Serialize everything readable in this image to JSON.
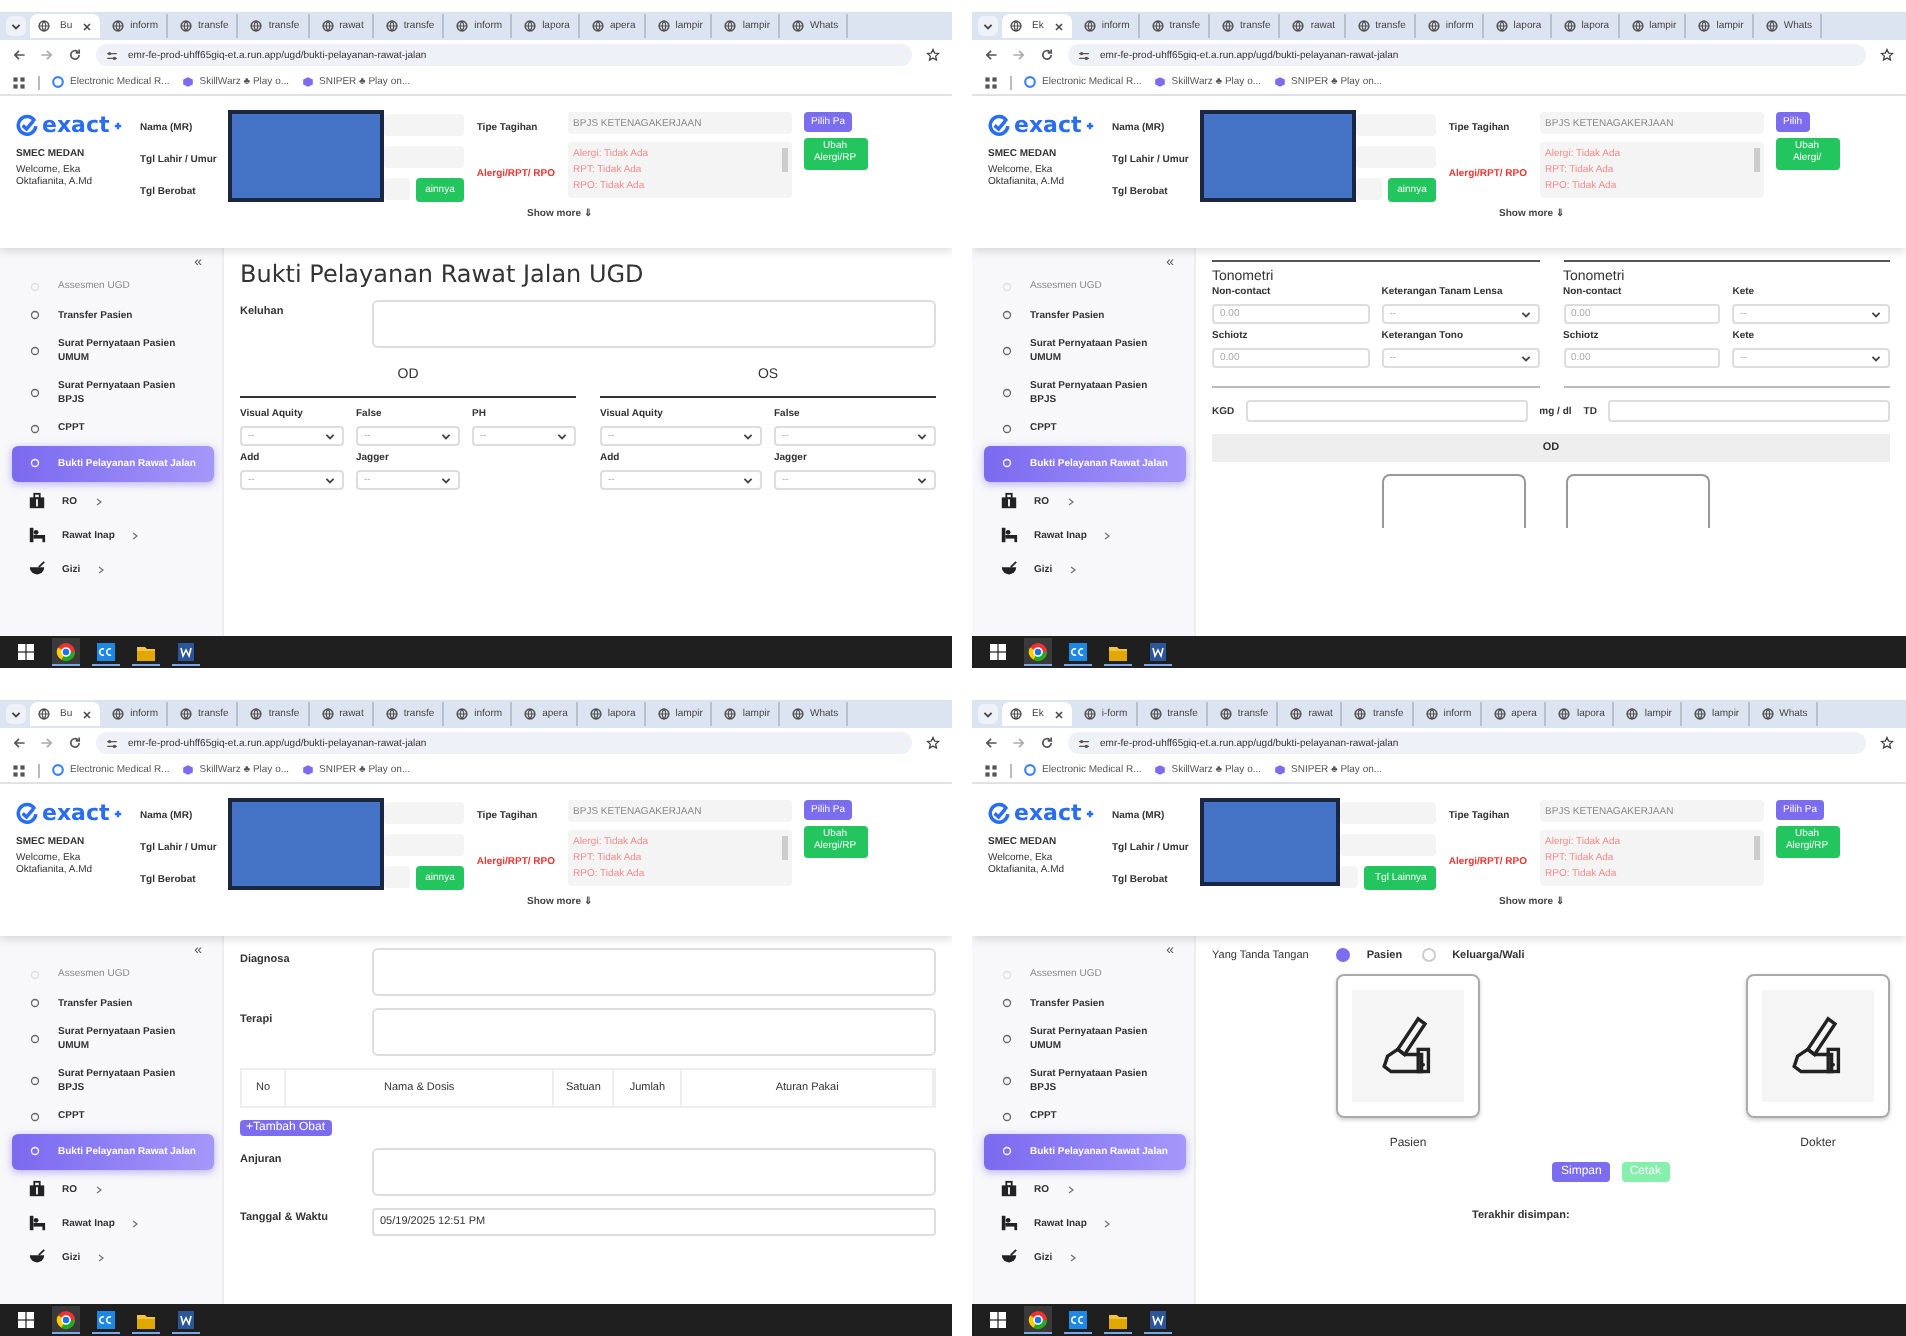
{
  "panels": [
    {
      "tabs": [
        {
          "label": "Bu",
          "selected": true
        },
        {
          "label": "inform",
          "selected": false
        },
        {
          "label": "transfe",
          "selected": false
        },
        {
          "label": "transfe",
          "selected": false
        },
        {
          "label": "rawat",
          "selected": false
        },
        {
          "label": "transfe",
          "selected": false
        },
        {
          "label": "inform",
          "selected": false
        },
        {
          "label": "lapora",
          "selected": false
        },
        {
          "label": "apera",
          "selected": false
        },
        {
          "label": "lampir",
          "selected": false
        },
        {
          "label": "lampir",
          "selected": false
        },
        {
          "label": "Whats",
          "selected": false
        }
      ],
      "url": "emr-fe-prod-uhff65giq-et.a.run.app/ugd/bukti-pelayanan-rawat-jalan",
      "bookmarks": [
        "Electronic Medical R...",
        "SkillWarz ♣ Play o...",
        "SNIPER ♣ Play on..."
      ],
      "header": {
        "logo": "exact",
        "clinic": "SMEC MEDAN",
        "welcome": "Welcome, Eka Oktafianita, A.Md",
        "labels": [
          "Nama (MR)",
          "Tgl Lahir / Umur",
          "Tgl Berobat"
        ],
        "date_button": "ainnya",
        "billing_label": "Tipe Tagihan",
        "billing_value": "BPJS KETENAGAKERJAAN",
        "allergy_label": "Alergi/RPT/ RPO",
        "allergy_lines": [
          "Alergi: Tidak Ada",
          "RPT: Tidak Ada",
          "RPO: Tidak Ada"
        ],
        "show_more": "Show more ⇓",
        "pick_button": "Pilih Pa",
        "edit_button": "Ubah Alergi/RP"
      },
      "sidebar": {
        "collapse": "«",
        "items": [
          {
            "label": "Assesmen UGD",
            "selected": false,
            "dimmed": true
          },
          {
            "label": "Transfer Pasien",
            "selected": false,
            "dimmed": false
          },
          {
            "label": "Surat Pernyataan Pasien UMUM",
            "selected": false,
            "dimmed": false
          },
          {
            "label": "Surat Pernyataan Pasien BPJS",
            "selected": false,
            "dimmed": false
          },
          {
            "label": "CPPT",
            "selected": false,
            "dimmed": false
          },
          {
            "label": "Bukti Pelayanan Rawat Jalan",
            "selected": true,
            "dimmed": false
          }
        ],
        "groups": [
          {
            "label": "RO",
            "kind": "case"
          },
          {
            "label": "Rawat Inap",
            "kind": "bed"
          },
          {
            "label": "Gizi",
            "kind": "bowl"
          }
        ]
      },
      "content": [
        {
          "kind": "title",
          "text": "Bukti Pelayanan Rawat Jalan UGD"
        },
        {
          "kind": "textarea",
          "label": "Keluhan"
        },
        {
          "kind": "grid",
          "sides": [
            {
              "heading": "OD",
              "rows": [
                [
                  {
                    "label": "Visual Aquity",
                    "value": "--",
                    "kind": "select"
                  },
                  {
                    "label": "False",
                    "value": "--",
                    "kind": "select"
                  },
                  {
                    "label": "PH",
                    "value": "--",
                    "kind": "select"
                  }
                ],
                [
                  {
                    "label": "Add",
                    "value": "--",
                    "kind": "select"
                  },
                  {
                    "label": "Jagger",
                    "value": "--",
                    "kind": "select"
                  }
                ]
              ]
            },
            {
              "heading": "OS",
              "rows": [
                [
                  {
                    "label": "Visual Aquity",
                    "value": "--",
                    "kind": "select"
                  },
                  {
                    "label": "False",
                    "value": "--",
                    "kind": "select"
                  }
                ],
                [
                  {
                    "label": "Add",
                    "value": "--",
                    "kind": "select"
                  },
                  {
                    "label": "Jagger",
                    "value": "--",
                    "kind": "select"
                  }
                ]
              ]
            }
          ]
        }
      ]
    },
    {
      "tabs": [
        {
          "label": "Ek",
          "selected": true
        },
        {
          "label": "inform",
          "selected": false
        },
        {
          "label": "transfe",
          "selected": false
        },
        {
          "label": "transfe",
          "selected": false
        },
        {
          "label": "rawat",
          "selected": false
        },
        {
          "label": "transfe",
          "selected": false
        },
        {
          "label": "inform",
          "selected": false
        },
        {
          "label": "lapora",
          "selected": false
        },
        {
          "label": "lapora",
          "selected": false
        },
        {
          "label": "lampir",
          "selected": false
        },
        {
          "label": "lampir",
          "selected": false
        },
        {
          "label": "Whats",
          "selected": false
        }
      ],
      "url": "emr-fe-prod-uhff65giq-et.a.run.app/ugd/bukti-pelayanan-rawat-jalan",
      "bookmarks": [
        "Electronic Medical R...",
        "SkillWarz ♣ Play o...",
        "SNIPER ♣ Play on..."
      ],
      "header": {
        "logo": "exact",
        "clinic": "SMEC MEDAN",
        "welcome": "Welcome, Eka Oktafianita, A.Md",
        "labels": [
          "Nama (MR)",
          "Tgl Lahir / Umur",
          "Tgl Berobat"
        ],
        "date_button": "ainnya",
        "billing_label": "Tipe Tagihan",
        "billing_value": "BPJS KETENAGAKERJAAN",
        "allergy_label": "Alergi/RPT/ RPO",
        "allergy_lines": [
          "Alergi: Tidak Ada",
          "RPT: Tidak Ada",
          "RPO: Tidak Ada"
        ],
        "show_more": "Show more ⇓",
        "pick_button": "Pilih",
        "edit_button": "Ubah Alergi/"
      },
      "sidebar": {
        "collapse": "«",
        "items": [
          {
            "label": "Assesmen UGD",
            "selected": false,
            "dimmed": true
          },
          {
            "label": "Transfer Pasien",
            "selected": false,
            "dimmed": false
          },
          {
            "label": "Surat Pernyataan Pasien UMUM",
            "selected": false,
            "dimmed": false
          },
          {
            "label": "Surat Pernyataan Pasien BPJS",
            "selected": false,
            "dimmed": false
          },
          {
            "label": "CPPT",
            "selected": false,
            "dimmed": false
          },
          {
            "label": "Bukti Pelayanan Rawat Jalan",
            "selected": true,
            "dimmed": false
          }
        ],
        "groups": [
          {
            "label": "RO",
            "kind": "case"
          },
          {
            "label": "Rawat Inap",
            "kind": "bed"
          },
          {
            "label": "Gizi",
            "kind": "bowl"
          }
        ]
      },
      "content": [
        {
          "kind": "grid",
          "sides": [
            {
              "title": "Tonometri",
              "rows": [
                [
                  {
                    "label": "Non-contact",
                    "placeholder": "0.00",
                    "kind": "input"
                  },
                  {
                    "label": "Keterangan Tanam Lensa",
                    "value": "--",
                    "kind": "select"
                  }
                ],
                [
                  {
                    "label": "Schiotz",
                    "placeholder": "0.00",
                    "kind": "input"
                  },
                  {
                    "label": "Keterangan Tono",
                    "value": "--",
                    "kind": "select"
                  }
                ]
              ]
            },
            {
              "title": "Tonometri",
              "rows": [
                [
                  {
                    "label": "Non-contact",
                    "placeholder": "0.00",
                    "kind": "input"
                  },
                  {
                    "label": "Kete",
                    "value": "--",
                    "kind": "select"
                  }
                ],
                [
                  {
                    "label": "Schiotz",
                    "placeholder": "0.00",
                    "kind": "input"
                  },
                  {
                    "label": "Kete",
                    "value": "--",
                    "kind": "select"
                  }
                ]
              ]
            }
          ]
        },
        {
          "kind": "measure",
          "label": "KGD",
          "unit": "mg / dl",
          "label2": "TD"
        },
        {
          "kind": "band",
          "text": "OD"
        },
        {
          "kind": "frames"
        }
      ]
    },
    {
      "tabs": [
        {
          "label": "Bu",
          "selected": true
        },
        {
          "label": "inform",
          "selected": false
        },
        {
          "label": "transfe",
          "selected": false
        },
        {
          "label": "transfe",
          "selected": false
        },
        {
          "label": "rawat",
          "selected": false
        },
        {
          "label": "transfe",
          "selected": false
        },
        {
          "label": "inform",
          "selected": false
        },
        {
          "label": "apera",
          "selected": false
        },
        {
          "label": "lapora",
          "selected": false
        },
        {
          "label": "lampir",
          "selected": false
        },
        {
          "label": "lampir",
          "selected": false
        },
        {
          "label": "Whats",
          "selected": false
        }
      ],
      "url": "emr-fe-prod-uhff65giq-et.a.run.app/ugd/bukti-pelayanan-rawat-jalan",
      "bookmarks": [
        "Electronic Medical R...",
        "SkillWarz ♣ Play o...",
        "SNIPER ♣ Play on..."
      ],
      "header": {
        "logo": "exact",
        "clinic": "SMEC MEDAN",
        "welcome": "Welcome, Eka Oktafianita, A.Md",
        "labels": [
          "Nama (MR)",
          "Tgl Lahir / Umur",
          "Tgl Berobat"
        ],
        "date_button": "ainnya",
        "billing_label": "Tipe Tagihan",
        "billing_value": "BPJS KETENAGAKERJAAN",
        "allergy_label": "Alergi/RPT/ RPO",
        "allergy_lines": [
          "Alergi: Tidak Ada",
          "RPT: Tidak Ada",
          "RPO: Tidak Ada"
        ],
        "show_more": "Show more ⇓",
        "pick_button": "Pilih Pa",
        "edit_button": "Ubah Alergi/RP"
      },
      "sidebar": {
        "collapse": "«",
        "items": [
          {
            "label": "Assesmen UGD",
            "selected": false,
            "dimmed": true
          },
          {
            "label": "Transfer Pasien",
            "selected": false,
            "dimmed": false
          },
          {
            "label": "Surat Pernyataan Pasien UMUM",
            "selected": false,
            "dimmed": false
          },
          {
            "label": "Surat Pernyataan Pasien BPJS",
            "selected": false,
            "dimmed": false
          },
          {
            "label": "CPPT",
            "selected": false,
            "dimmed": false
          },
          {
            "label": "Bukti Pelayanan Rawat Jalan",
            "selected": true,
            "dimmed": false
          }
        ],
        "groups": [
          {
            "label": "RO",
            "kind": "case"
          },
          {
            "label": "Rawat Inap",
            "kind": "bed"
          },
          {
            "label": "Gizi",
            "kind": "bowl"
          }
        ]
      },
      "content": [
        {
          "kind": "textarea",
          "label": "Diagnosa"
        },
        {
          "kind": "textarea",
          "label": "Terapi"
        },
        {
          "kind": "table",
          "columns": [
            "No",
            "Nama & Dosis",
            "Satuan",
            "Jumlah",
            "Aturan Pakai"
          ]
        },
        {
          "kind": "button",
          "text": "+Tambah Obat"
        },
        {
          "kind": "textarea",
          "label": "Anjuran"
        },
        {
          "kind": "input",
          "label": "Tanggal & Waktu",
          "value": "05/19/2025 12:51 PM"
        }
      ]
    },
    {
      "tabs": [
        {
          "label": "Ek",
          "selected": true
        },
        {
          "label": "i-form",
          "selected": false
        },
        {
          "label": "transfe",
          "selected": false
        },
        {
          "label": "transfe",
          "selected": false
        },
        {
          "label": "rawat",
          "selected": false
        },
        {
          "label": "transfe",
          "selected": false
        },
        {
          "label": "inform",
          "selected": false
        },
        {
          "label": "apera",
          "selected": false
        },
        {
          "label": "lapora",
          "selected": false
        },
        {
          "label": "lampir",
          "selected": false
        },
        {
          "label": "lampir",
          "selected": false
        },
        {
          "label": "Whats",
          "selected": false
        }
      ],
      "url": "emr-fe-prod-uhff65giq-et.a.run.app/ugd/bukti-pelayanan-rawat-jalan",
      "bookmarks": [
        "Electronic Medical R...",
        "SkillWarz ♣ Play o...",
        "SNIPER ♣ Play on..."
      ],
      "header": {
        "logo": "exact",
        "clinic": "SMEC MEDAN",
        "welcome": "Welcome, Eka Oktafianita, A.Md",
        "labels": [
          "Nama (MR)",
          "Tgl Lahir / Umur",
          "Tgl Berobat"
        ],
        "date_button": "Tgl Lainnya",
        "billing_label": "Tipe Tagihan",
        "billing_value": "BPJS KETENAGAKERJAAN",
        "allergy_label": "Alergi/RPT/ RPO",
        "allergy_lines": [
          "Alergi: Tidak Ada",
          "RPT: Tidak Ada",
          "RPO: Tidak Ada"
        ],
        "show_more": "Show more ⇓",
        "pick_button": "Pilih Pa",
        "edit_button": "Ubah Alergi/RP"
      },
      "sidebar": {
        "collapse": "«",
        "items": [
          {
            "label": "Assesmen UGD",
            "selected": false,
            "dimmed": true
          },
          {
            "label": "Transfer Pasien",
            "selected": false,
            "dimmed": false
          },
          {
            "label": "Surat Pernyataan Pasien UMUM",
            "selected": false,
            "dimmed": false
          },
          {
            "label": "Surat Pernyataan Pasien BPJS",
            "selected": false,
            "dimmed": false
          },
          {
            "label": "CPPT",
            "selected": false,
            "dimmed": false
          },
          {
            "label": "Bukti Pelayanan Rawat Jalan",
            "selected": true,
            "dimmed": false
          }
        ],
        "groups": [
          {
            "label": "RO",
            "kind": "case"
          },
          {
            "label": "Rawat Inap",
            "kind": "bed"
          },
          {
            "label": "Gizi",
            "kind": "bowl"
          }
        ]
      },
      "content": [
        {
          "kind": "radios",
          "label": "Yang Tanda Tangan",
          "options": [
            {
              "label": "Pasien",
              "selected": true
            },
            {
              "label": "Keluarga/Wali",
              "selected": false
            }
          ]
        },
        {
          "kind": "signatures",
          "items": [
            "Pasien",
            "Dokter"
          ]
        },
        {
          "kind": "actions",
          "buttons": [
            {
              "label": "Simpan",
              "disabled": false
            },
            {
              "label": "Cetak",
              "disabled": true
            }
          ]
        },
        {
          "kind": "text",
          "text": "Terakhir disimpan:"
        }
      ]
    }
  ]
}
